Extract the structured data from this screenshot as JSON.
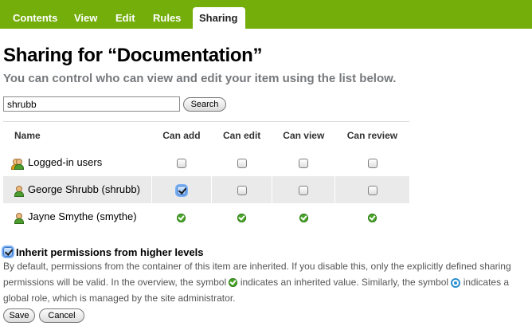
{
  "tabs": [
    {
      "label": "Contents",
      "active": false
    },
    {
      "label": "View",
      "active": false
    },
    {
      "label": "Edit",
      "active": false
    },
    {
      "label": "Rules",
      "active": false
    },
    {
      "label": "Sharing",
      "active": true
    }
  ],
  "page": {
    "title": "Sharing for “Documentation”",
    "subtitle": "You can control who can view and edit your item using the list below."
  },
  "search": {
    "value": "shrubb",
    "button_label": "Search"
  },
  "table": {
    "headers": [
      "Name",
      "Can add",
      "Can edit",
      "Can view",
      "Can review"
    ],
    "rows": [
      {
        "name": "Logged-in users",
        "icon": "group-icon",
        "cells": [
          "unchecked",
          "unchecked",
          "unchecked",
          "unchecked"
        ]
      },
      {
        "name": "George Shrubb (shrubb)",
        "icon": "user-icon",
        "cells": [
          "checked",
          "unchecked",
          "unchecked",
          "unchecked"
        ]
      },
      {
        "name": "Jayne Smythe (smythe)",
        "icon": "user-icon",
        "cells": [
          "inherited",
          "inherited",
          "inherited",
          "inherited"
        ]
      }
    ]
  },
  "inherit": {
    "checked": true,
    "label": "Inherit permissions from higher levels",
    "desc_part1": "By default, permissions from the container of this item are inherited. If you disable this, only the explicitly defined sharing permissions will be valid. In the overview, the symbol",
    "desc_part2": "indicates an inherited value. Similarly, the symbol",
    "desc_part3": "indicates a global role, which is managed by the site administrator."
  },
  "actions": {
    "save_label": "Save",
    "cancel_label": "Cancel"
  },
  "colors": {
    "tabbar": "#74ae0b",
    "subtitle": "#76797c",
    "highlight_row": "#eaeaea",
    "inherited_tick": "#4aa52a",
    "global_role": "#2a8fd0"
  }
}
